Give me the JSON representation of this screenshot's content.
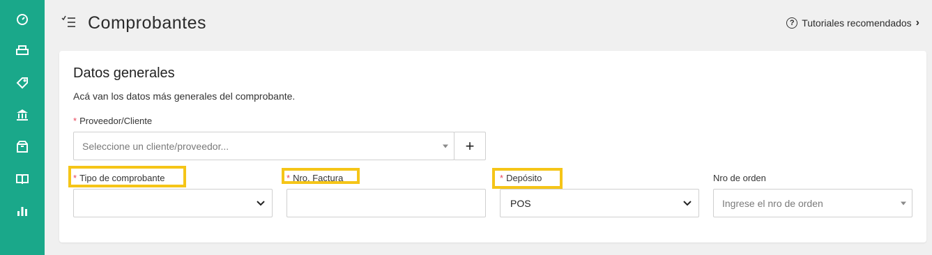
{
  "sidebar": {
    "items": [
      {
        "icon": "dashboard-gauge-icon"
      },
      {
        "icon": "printer-icon"
      },
      {
        "icon": "tag-icon"
      },
      {
        "icon": "bank-icon"
      },
      {
        "icon": "box-icon"
      },
      {
        "icon": "book-open-icon"
      },
      {
        "icon": "bar-chart-icon"
      }
    ],
    "color": "#1aa88a"
  },
  "header": {
    "title": "Comprobantes",
    "tutorials_label": "Tutoriales recomendados",
    "help_glyph": "?",
    "chevron_glyph": "›"
  },
  "card": {
    "title": "Datos generales",
    "description": "Acá van los datos más generales del comprobante.",
    "required_mark": "*",
    "fields": {
      "proveedor": {
        "label": "Proveedor/Cliente",
        "placeholder": "Seleccione un cliente/proveedor...",
        "add_label": "+"
      },
      "tipo": {
        "label": "Tipo de comprobante",
        "value": ""
      },
      "factura": {
        "label": "Nro. Factura",
        "value": ""
      },
      "deposito": {
        "label": "Depósito",
        "value": "POS"
      },
      "orden": {
        "label": "Nro de orden",
        "placeholder": "Ingrese el nro de orden"
      }
    }
  },
  "highlight_color": "#f5c518",
  "required_color": "#e8465a"
}
